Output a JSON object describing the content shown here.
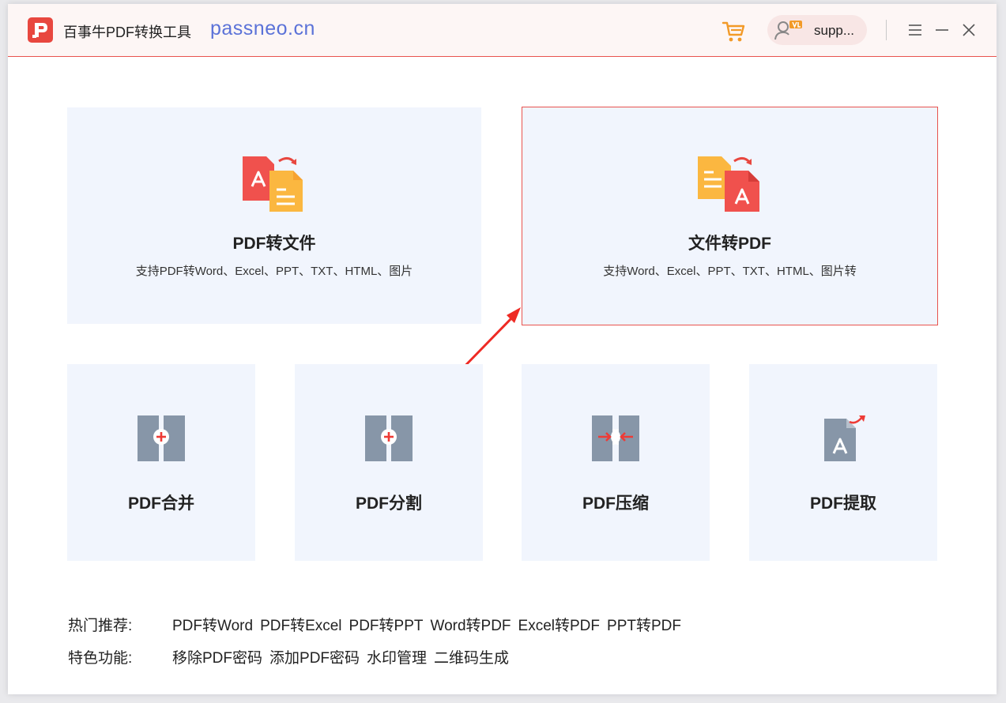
{
  "app": {
    "title": "百事牛PDF转换工具",
    "site": "passneo.cn",
    "accent_color": "#e8473f",
    "user_name": "supp..."
  },
  "icons": {
    "logo": "logo-icon",
    "cart": "cart-icon",
    "user": "user-vip-icon",
    "menu": "menu-icon",
    "minimize": "minimize-icon",
    "close": "close-icon"
  },
  "main_cards": [
    {
      "title": "PDF转文件",
      "desc": "支持PDF转Word、Excel、PPT、TXT、HTML、图片",
      "icon": "pdf-to-file-icon"
    },
    {
      "title": "文件转PDF",
      "desc": "支持Word、Excel、PPT、TXT、HTML、图片转",
      "icon": "file-to-pdf-icon",
      "selected": true
    }
  ],
  "tool_cards": [
    {
      "title": "PDF合并",
      "icon": "pdf-merge-icon"
    },
    {
      "title": "PDF分割",
      "icon": "pdf-split-icon"
    },
    {
      "title": "PDF压缩",
      "icon": "pdf-compress-icon"
    },
    {
      "title": "PDF提取",
      "icon": "pdf-extract-icon"
    }
  ],
  "hot": {
    "label": "热门推荐:",
    "links": [
      "PDF转Word",
      "PDF转Excel",
      "PDF转PPT",
      "Word转PDF",
      "Excel转PDF",
      "PPT转PDF"
    ]
  },
  "features": {
    "label": "特色功能:",
    "links": [
      "移除PDF密码",
      "添加PDF密码",
      "水印管理",
      "二维码生成"
    ]
  }
}
